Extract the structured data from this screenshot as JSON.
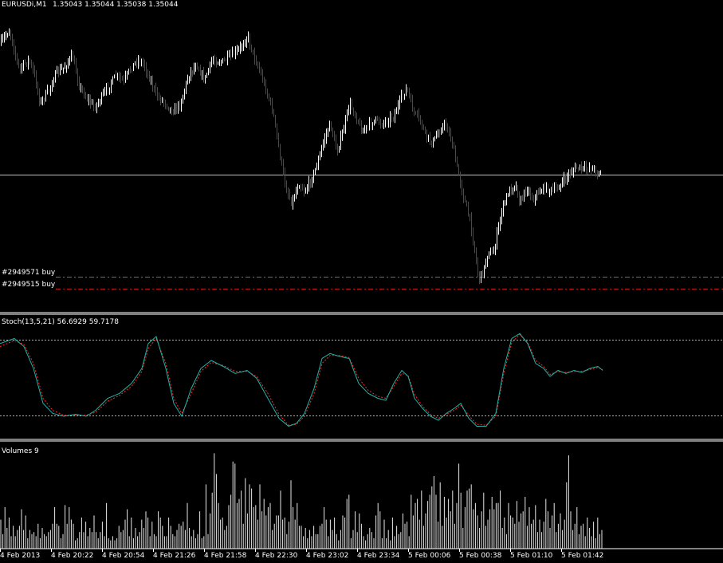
{
  "header": {
    "symbol": "EURUSDi,M1",
    "quote": "1.35043 1.35044 1.35038 1.35044"
  },
  "orders": [
    {
      "label": "#2949571 buy",
      "color": "#1ea81e"
    },
    {
      "label": "#2949515 buy",
      "color": "#c01818"
    }
  ],
  "stoch": {
    "label": "Stoch(13,5,21) 56.6929 59.7178",
    "main_color": "#20b2aa",
    "signal_color": "#ff2a2a"
  },
  "volumes": {
    "label": "Volumes 9"
  },
  "xaxis": {
    "labels": [
      "4 Feb 2013",
      "4 Feb 20:22",
      "4 Feb 20:54",
      "4 Feb 21:26",
      "4 Feb 21:58",
      "4 Feb 22:30",
      "4 Feb 23:02",
      "4 Feb 23:34",
      "5 Feb 00:06",
      "5 Feb 00:38",
      "5 Feb 01:10",
      "5 Feb 01:42"
    ]
  },
  "colors": {
    "bull": "#ffffff",
    "bear": "#c81414",
    "grid": "#c0c0c0"
  },
  "chart_data": [
    {
      "type": "candlestick",
      "title": "EURUSDi,M1",
      "price_anchors": [
        [
          0,
          55
        ],
        [
          8,
          42
        ],
        [
          12,
          38
        ],
        [
          18,
          65
        ],
        [
          24,
          88
        ],
        [
          30,
          80
        ],
        [
          36,
          75
        ],
        [
          44,
          98
        ],
        [
          50,
          130
        ],
        [
          60,
          115
        ],
        [
          70,
          92
        ],
        [
          80,
          85
        ],
        [
          90,
          70
        ],
        [
          100,
          110
        ],
        [
          110,
          125
        ],
        [
          118,
          135
        ],
        [
          125,
          125
        ],
        [
          135,
          110
        ],
        [
          145,
          95
        ],
        [
          155,
          102
        ],
        [
          162,
          88
        ],
        [
          172,
          75
        ],
        [
          180,
          80
        ],
        [
          188,
          100
        ],
        [
          196,
          120
        ],
        [
          206,
          128
        ],
        [
          216,
          140
        ],
        [
          226,
          130
        ],
        [
          236,
          95
        ],
        [
          246,
          80
        ],
        [
          256,
          100
        ],
        [
          266,
          75
        ],
        [
          278,
          78
        ],
        [
          290,
          70
        ],
        [
          300,
          62
        ],
        [
          310,
          45
        ],
        [
          318,
          70
        ],
        [
          326,
          90
        ],
        [
          334,
          115
        ],
        [
          342,
          140
        ],
        [
          350,
          190
        ],
        [
          358,
          235
        ],
        [
          366,
          255
        ],
        [
          374,
          230
        ],
        [
          382,
          240
        ],
        [
          390,
          225
        ],
        [
          398,
          205
        ],
        [
          406,
          175
        ],
        [
          414,
          155
        ],
        [
          422,
          190
        ],
        [
          430,
          165
        ],
        [
          438,
          130
        ],
        [
          446,
          145
        ],
        [
          454,
          165
        ],
        [
          462,
          158
        ],
        [
          470,
          150
        ],
        [
          478,
          155
        ],
        [
          486,
          150
        ],
        [
          494,
          145
        ],
        [
          502,
          125
        ],
        [
          510,
          110
        ],
        [
          518,
          140
        ],
        [
          526,
          150
        ],
        [
          534,
          170
        ],
        [
          542,
          180
        ],
        [
          550,
          165
        ],
        [
          558,
          155
        ],
        [
          566,
          175
        ],
        [
          574,
          215
        ],
        [
          582,
          250
        ],
        [
          590,
          280
        ],
        [
          596,
          320
        ],
        [
          600,
          350
        ],
        [
          606,
          340
        ],
        [
          612,
          315
        ],
        [
          618,
          320
        ],
        [
          624,
          290
        ],
        [
          630,
          260
        ],
        [
          638,
          240
        ],
        [
          646,
          230
        ],
        [
          652,
          255
        ],
        [
          660,
          235
        ],
        [
          668,
          250
        ],
        [
          676,
          240
        ],
        [
          684,
          235
        ],
        [
          692,
          240
        ],
        [
          700,
          235
        ],
        [
          708,
          225
        ],
        [
          716,
          215
        ],
        [
          724,
          210
        ],
        [
          732,
          212
        ],
        [
          740,
          210
        ],
        [
          748,
          215
        ],
        [
          754,
          218
        ]
      ],
      "bid_level": "1.35044",
      "orders": [
        "#2949571 buy",
        "#2949515 buy"
      ]
    },
    {
      "type": "line",
      "title": "Stoch(13,5,21)",
      "main_value": 56.6929,
      "signal_value": 59.7178,
      "levels": [
        80,
        20
      ],
      "ylim": [
        0,
        100
      ],
      "x": [
        0,
        18,
        30,
        42,
        54,
        66,
        80,
        95,
        108,
        120,
        135,
        150,
        165,
        178,
        186,
        196,
        208,
        218,
        228,
        240,
        252,
        265,
        280,
        295,
        310,
        322,
        336,
        350,
        362,
        372,
        382,
        394,
        404,
        414,
        426,
        438,
        450,
        462,
        474,
        484,
        494,
        504,
        512,
        520,
        530,
        540,
        550,
        560,
        570,
        578,
        588,
        598,
        610,
        622,
        632,
        642,
        652,
        662,
        672,
        682,
        690,
        700,
        710,
        720,
        730,
        740,
        750,
        756
      ],
      "main": [
        85,
        90,
        82,
        60,
        25,
        15,
        12,
        14,
        12,
        18,
        30,
        35,
        45,
        60,
        85,
        92,
        60,
        25,
        12,
        40,
        60,
        68,
        62,
        55,
        58,
        50,
        30,
        10,
        2,
        5,
        15,
        40,
        70,
        75,
        72,
        70,
        45,
        35,
        30,
        28,
        45,
        58,
        52,
        30,
        20,
        12,
        8,
        15,
        20,
        25,
        10,
        2,
        2,
        15,
        60,
        90,
        95,
        85,
        65,
        60,
        52,
        58,
        55,
        58,
        56,
        60,
        62,
        58
      ],
      "signal": [
        82,
        88,
        84,
        65,
        30,
        18,
        13,
        13,
        13,
        16,
        27,
        33,
        42,
        57,
        80,
        90,
        65,
        30,
        15,
        35,
        57,
        66,
        63,
        57,
        57,
        52,
        35,
        14,
        3,
        4,
        12,
        35,
        65,
        73,
        73,
        71,
        50,
        38,
        32,
        30,
        42,
        55,
        53,
        34,
        22,
        14,
        10,
        14,
        18,
        23,
        13,
        4,
        3,
        12,
        55,
        86,
        94,
        86,
        68,
        62,
        54,
        57,
        56,
        57,
        57,
        59,
        61,
        59
      ],
      "series": [
        {
          "name": "main"
        },
        {
          "name": "signal"
        }
      ]
    },
    {
      "type": "bar",
      "title": "Volumes",
      "last_value": 9,
      "values": [
        28,
        14,
        40,
        20,
        30,
        12,
        22,
        12,
        18,
        22,
        38,
        18,
        32,
        10,
        18,
        14,
        16,
        12,
        24,
        10,
        20,
        14,
        12,
        16,
        18,
        24,
        40,
        24,
        22,
        10,
        14,
        42,
        24,
        40,
        28,
        24,
        8,
        10,
        16,
        30,
        16,
        26,
        12,
        20,
        16,
        32,
        16,
        10,
        16,
        26,
        12,
        44,
        10,
        8,
        12,
        8,
        10,
        22,
        16,
        18,
        28,
        38,
        12,
        30,
        10,
        20,
        12,
        16,
        28,
        20,
        36,
        30,
        12,
        26,
        14,
        12,
        36,
        30,
        22,
        12,
        12,
        30,
        22,
        14,
        12,
        18,
        24,
        22,
        26,
        18,
        44,
        20,
        12,
        18,
        10,
        14,
        36,
        10,
        12,
        62,
        14,
        34,
        54,
        92,
        72,
        44,
        28,
        30,
        18,
        22,
        42,
        52,
        84,
        82,
        44,
        48,
        56,
        24,
        68,
        34,
        62,
        58,
        40,
        42,
        28,
        62,
        36,
        48,
        32,
        40,
        44,
        18,
        24,
        32,
        32,
        56,
        28,
        30,
        14,
        26,
        66,
        40,
        28,
        44,
        22,
        22,
        12,
        20,
        10,
        18,
        12,
        22,
        14,
        14,
        22,
        24,
        40,
        28,
        12,
        28,
        18,
        30,
        14,
        8,
        18,
        32,
        30,
        48,
        52,
        10,
        18,
        36,
        16,
        34,
        24,
        12,
        8,
        14,
        20,
        16,
        10,
        32,
        44,
        36,
        10,
        28,
        10,
        18,
        8,
        30,
        12,
        22,
        14,
        16,
        34,
        24,
        26,
        12,
        52,
        32,
        44,
        48,
        28,
        56,
        22,
        34,
        46,
        52,
        60,
        70,
        52,
        26,
        64,
        22,
        50,
        30,
        48,
        36,
        56,
        24,
        44,
        82,
        54,
        20,
        40,
        56,
        58,
        62,
        38,
        44,
        32,
        20,
        36,
        54,
        22,
        28,
        38,
        50,
        38,
        44,
        44,
        56,
        20,
        30,
        14,
        44,
        32,
        30,
        24,
        46,
        26,
        34,
        36,
        50,
        22,
        40,
        24,
        28,
        42,
        16,
        28,
        16,
        26,
        48,
        36,
        20,
        32,
        44,
        16,
        24,
        34,
        18,
        28,
        64,
        90,
        36,
        18,
        24,
        40,
        14,
        22,
        24,
        12,
        30,
        20,
        12,
        26,
        10,
        30,
        14,
        18,
        34,
        14,
        9
      ]
    }
  ]
}
